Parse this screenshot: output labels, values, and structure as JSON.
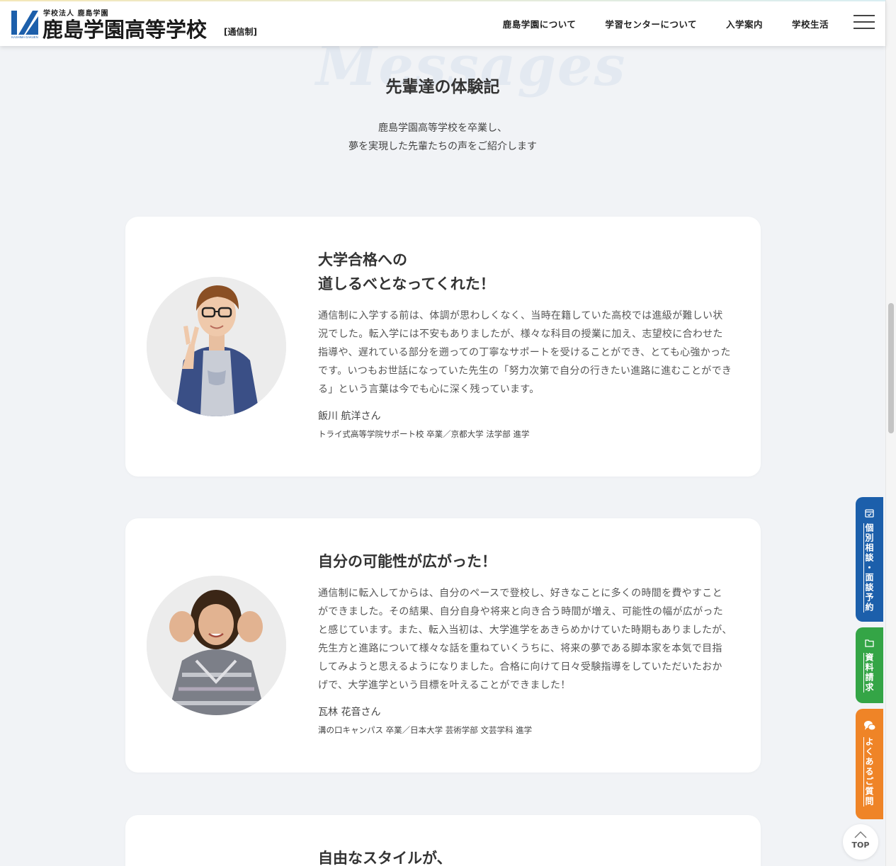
{
  "header": {
    "logo_small": "学校法人 鹿島学園",
    "logo_main": "鹿島学園高等学校",
    "logo_tag": "[通信制]",
    "logo_mark_caption": "KASHIMA GAKUEN",
    "nav": [
      "鹿島学園について",
      "学習センターについて",
      "入学案内",
      "学校生活"
    ]
  },
  "section": {
    "bg_word": "Messages",
    "title": "先輩達の体験記",
    "lead_line1": "鹿島学園高等学校を卒業し、",
    "lead_line2": "夢を実現した先輩たちの声をご紹介します"
  },
  "cards": [
    {
      "title_line1": "大学合格への",
      "title_line2": "道しるべとなってくれた！",
      "text": "通信制に入学する前は、体調が思わしくなく、当時在籍していた高校では進級が難しい状況でした。転入学には不安もありましたが、様々な科目の授業に加え、志望校に合わせた指導や、遅れている部分を遡っての丁寧なサポートを受けることができ、とても心強かったです。いつもお世話になっていた先生の「努力次第で自分の行きたい進路に進むことができる」という言葉は今でも心に深く残っています。",
      "name": "飯川 航洋さん",
      "info": "トライ式高等学院サポート校 卒業／京都大学 法学部 進学"
    },
    {
      "title_line1": "自分の可能性が広がった！",
      "text": "通信制に転入してからは、自分のペースで登校し、好きなことに多くの時間を費やすことができました。その結果、自分自身や将来と向き合う時間が増え、可能性の幅が広がったと感じています。また、転入当初は、大学進学をあきらめかけていた時期もありましたが、先生方と進路について様々な話を重ねていくうちに、将来の夢である脚本家を本気で目指してみようと思えるようになりました。合格に向けて日々受験指導をしていただいたおかげで、大学進学という目標を叶えることができました！",
      "name": "瓦林 花音さん",
      "info": "溝の口キャンパス 卒業／日本大学 芸術学部 文芸学科 進学"
    },
    {
      "title_line1": "自由なスタイルが、"
    }
  ],
  "side_tabs": {
    "consult": "個別相談・面談予約",
    "request": "資料請求",
    "faq": "よくあるご質問"
  },
  "top_button": "TOP",
  "colors": {
    "brand_blue": "#1c5fab",
    "green": "#34a546",
    "orange": "#ef8427",
    "background": "#f1f3f6"
  }
}
